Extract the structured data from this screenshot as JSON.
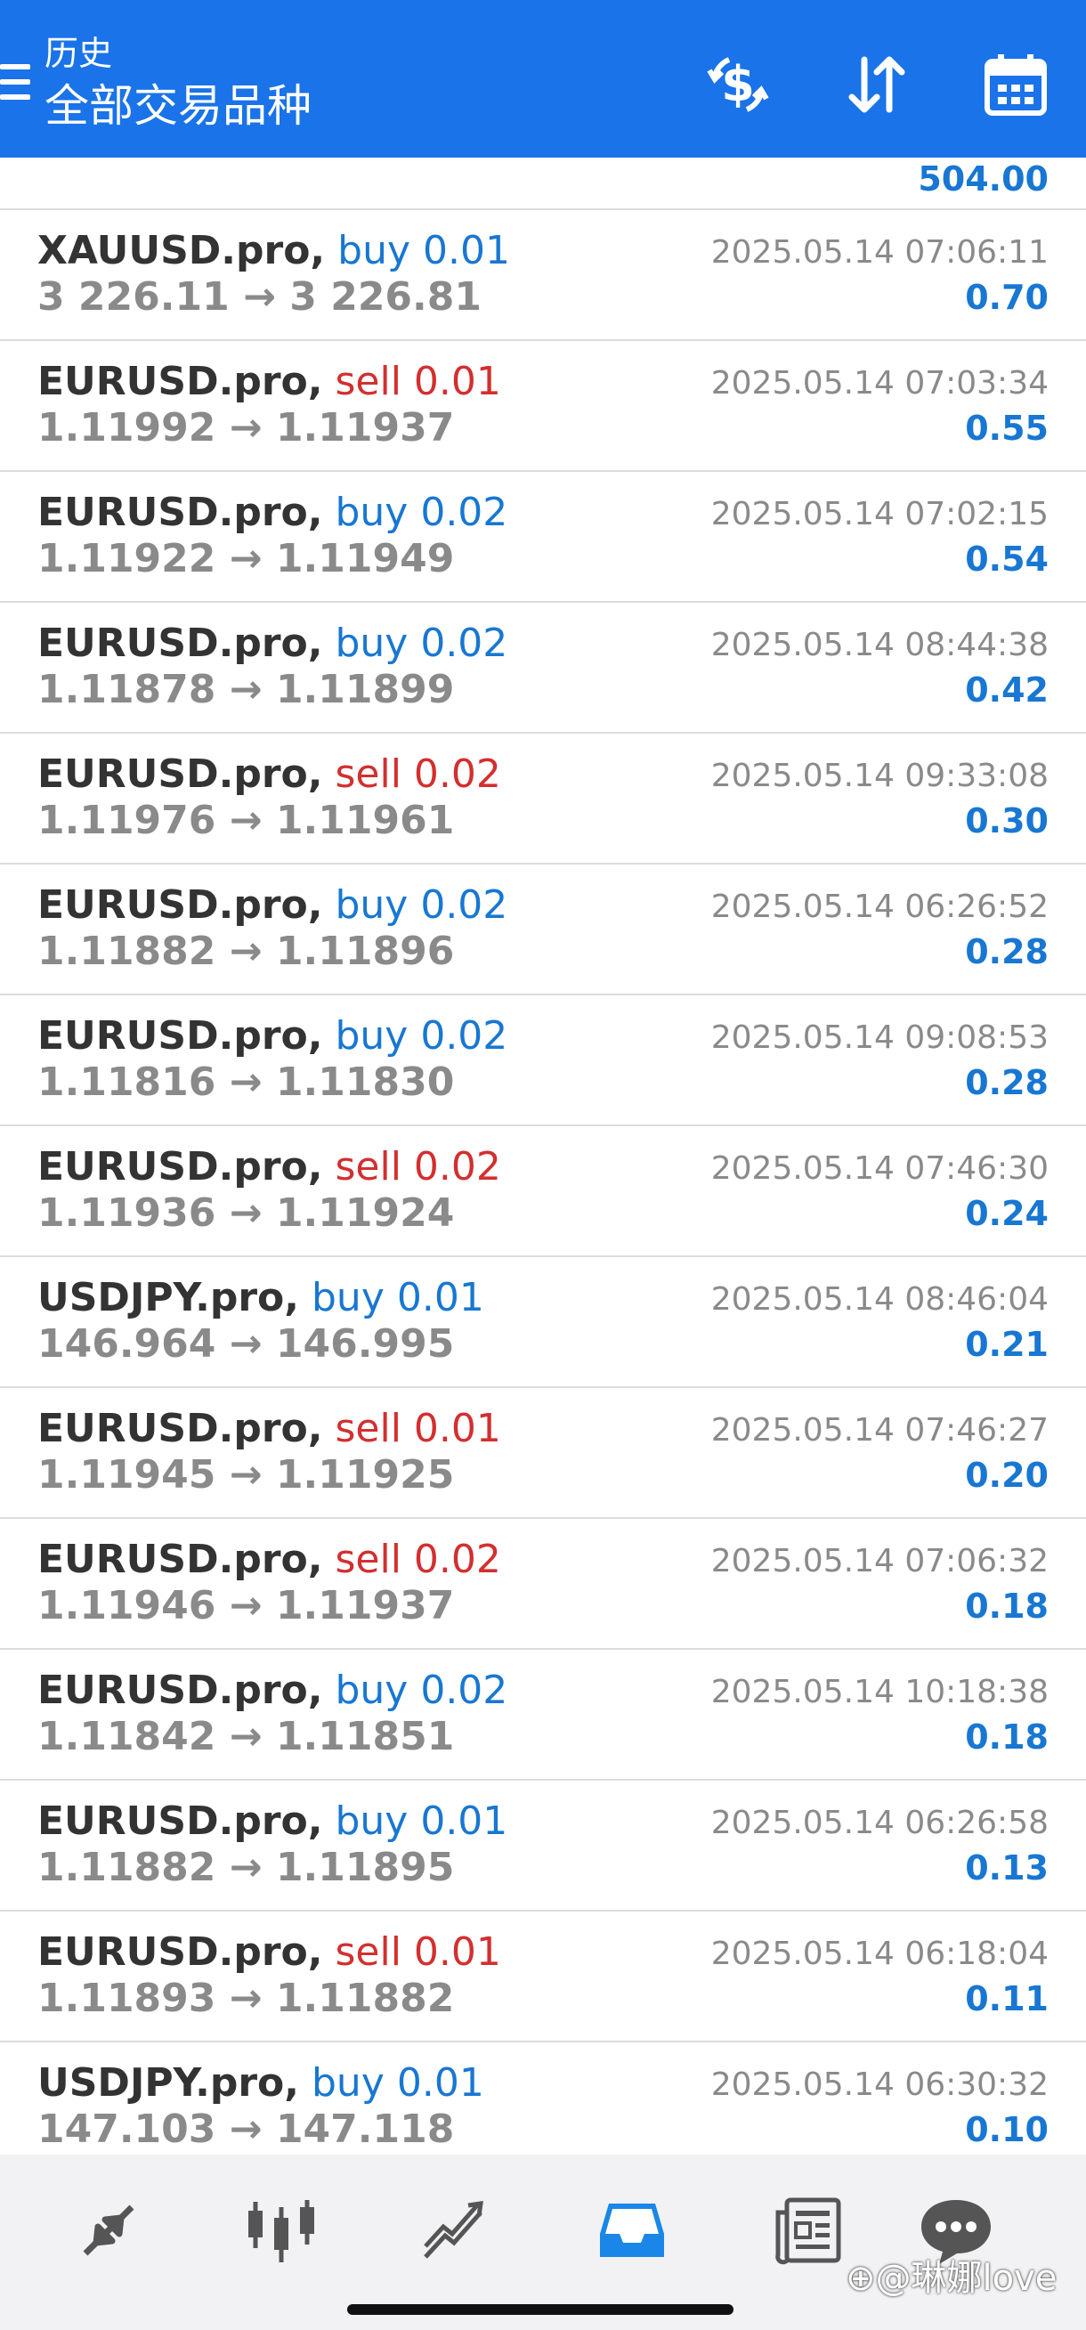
{
  "header": {
    "subtitle": "历史",
    "title": "全部交易品种"
  },
  "partial_row": {
    "profit": "504.00"
  },
  "trades": [
    {
      "symbol": "XAUUSD.pro,",
      "side": "buy",
      "volume": "0.01",
      "open": "3 226.11",
      "close": "3 226.81",
      "time": "2025.05.14 07:06:11",
      "profit": "0.70"
    },
    {
      "symbol": "EURUSD.pro,",
      "side": "sell",
      "volume": "0.01",
      "open": "1.11992",
      "close": "1.11937",
      "time": "2025.05.14 07:03:34",
      "profit": "0.55"
    },
    {
      "symbol": "EURUSD.pro,",
      "side": "buy",
      "volume": "0.02",
      "open": "1.11922",
      "close": "1.11949",
      "time": "2025.05.14 07:02:15",
      "profit": "0.54"
    },
    {
      "symbol": "EURUSD.pro,",
      "side": "buy",
      "volume": "0.02",
      "open": "1.11878",
      "close": "1.11899",
      "time": "2025.05.14 08:44:38",
      "profit": "0.42"
    },
    {
      "symbol": "EURUSD.pro,",
      "side": "sell",
      "volume": "0.02",
      "open": "1.11976",
      "close": "1.11961",
      "time": "2025.05.14 09:33:08",
      "profit": "0.30"
    },
    {
      "symbol": "EURUSD.pro,",
      "side": "buy",
      "volume": "0.02",
      "open": "1.11882",
      "close": "1.11896",
      "time": "2025.05.14 06:26:52",
      "profit": "0.28"
    },
    {
      "symbol": "EURUSD.pro,",
      "side": "buy",
      "volume": "0.02",
      "open": "1.11816",
      "close": "1.11830",
      "time": "2025.05.14 09:08:53",
      "profit": "0.28"
    },
    {
      "symbol": "EURUSD.pro,",
      "side": "sell",
      "volume": "0.02",
      "open": "1.11936",
      "close": "1.11924",
      "time": "2025.05.14 07:46:30",
      "profit": "0.24"
    },
    {
      "symbol": "USDJPY.pro,",
      "side": "buy",
      "volume": "0.01",
      "open": "146.964",
      "close": "146.995",
      "time": "2025.05.14 08:46:04",
      "profit": "0.21"
    },
    {
      "symbol": "EURUSD.pro,",
      "side": "sell",
      "volume": "0.01",
      "open": "1.11945",
      "close": "1.11925",
      "time": "2025.05.14 07:46:27",
      "profit": "0.20"
    },
    {
      "symbol": "EURUSD.pro,",
      "side": "sell",
      "volume": "0.02",
      "open": "1.11946",
      "close": "1.11937",
      "time": "2025.05.14 07:06:32",
      "profit": "0.18"
    },
    {
      "symbol": "EURUSD.pro,",
      "side": "buy",
      "volume": "0.02",
      "open": "1.11842",
      "close": "1.11851",
      "time": "2025.05.14 10:18:38",
      "profit": "0.18"
    },
    {
      "symbol": "EURUSD.pro,",
      "side": "buy",
      "volume": "0.01",
      "open": "1.11882",
      "close": "1.11895",
      "time": "2025.05.14 06:26:58",
      "profit": "0.13"
    },
    {
      "symbol": "EURUSD.pro,",
      "side": "sell",
      "volume": "0.01",
      "open": "1.11893",
      "close": "1.11882",
      "time": "2025.05.14 06:18:04",
      "profit": "0.11"
    },
    {
      "symbol": "USDJPY.pro,",
      "side": "buy",
      "volume": "0.01",
      "open": "147.103",
      "close": "147.118",
      "time": "2025.05.14 06:30:32",
      "profit": "0.10"
    }
  ],
  "arrow": "→",
  "bottom_nav": [
    {
      "name": "quotes",
      "icon": "arrows-diagonal-icon"
    },
    {
      "name": "chart",
      "icon": "candlestick-icon"
    },
    {
      "name": "trade",
      "icon": "trend-lines-icon"
    },
    {
      "name": "history",
      "icon": "inbox-tray-icon",
      "active": true
    },
    {
      "name": "news",
      "icon": "newspaper-icon"
    },
    {
      "name": "messages",
      "icon": "chat-bubble-icon"
    }
  ],
  "watermark": "⊕@琳娜love",
  "colors": {
    "appbar": "#1a73e8",
    "buy": "#1877d2",
    "sell": "#d32f2f",
    "profit": "#1877d2",
    "nav_active": "#1a87e8",
    "nav_inactive": "#555555"
  }
}
